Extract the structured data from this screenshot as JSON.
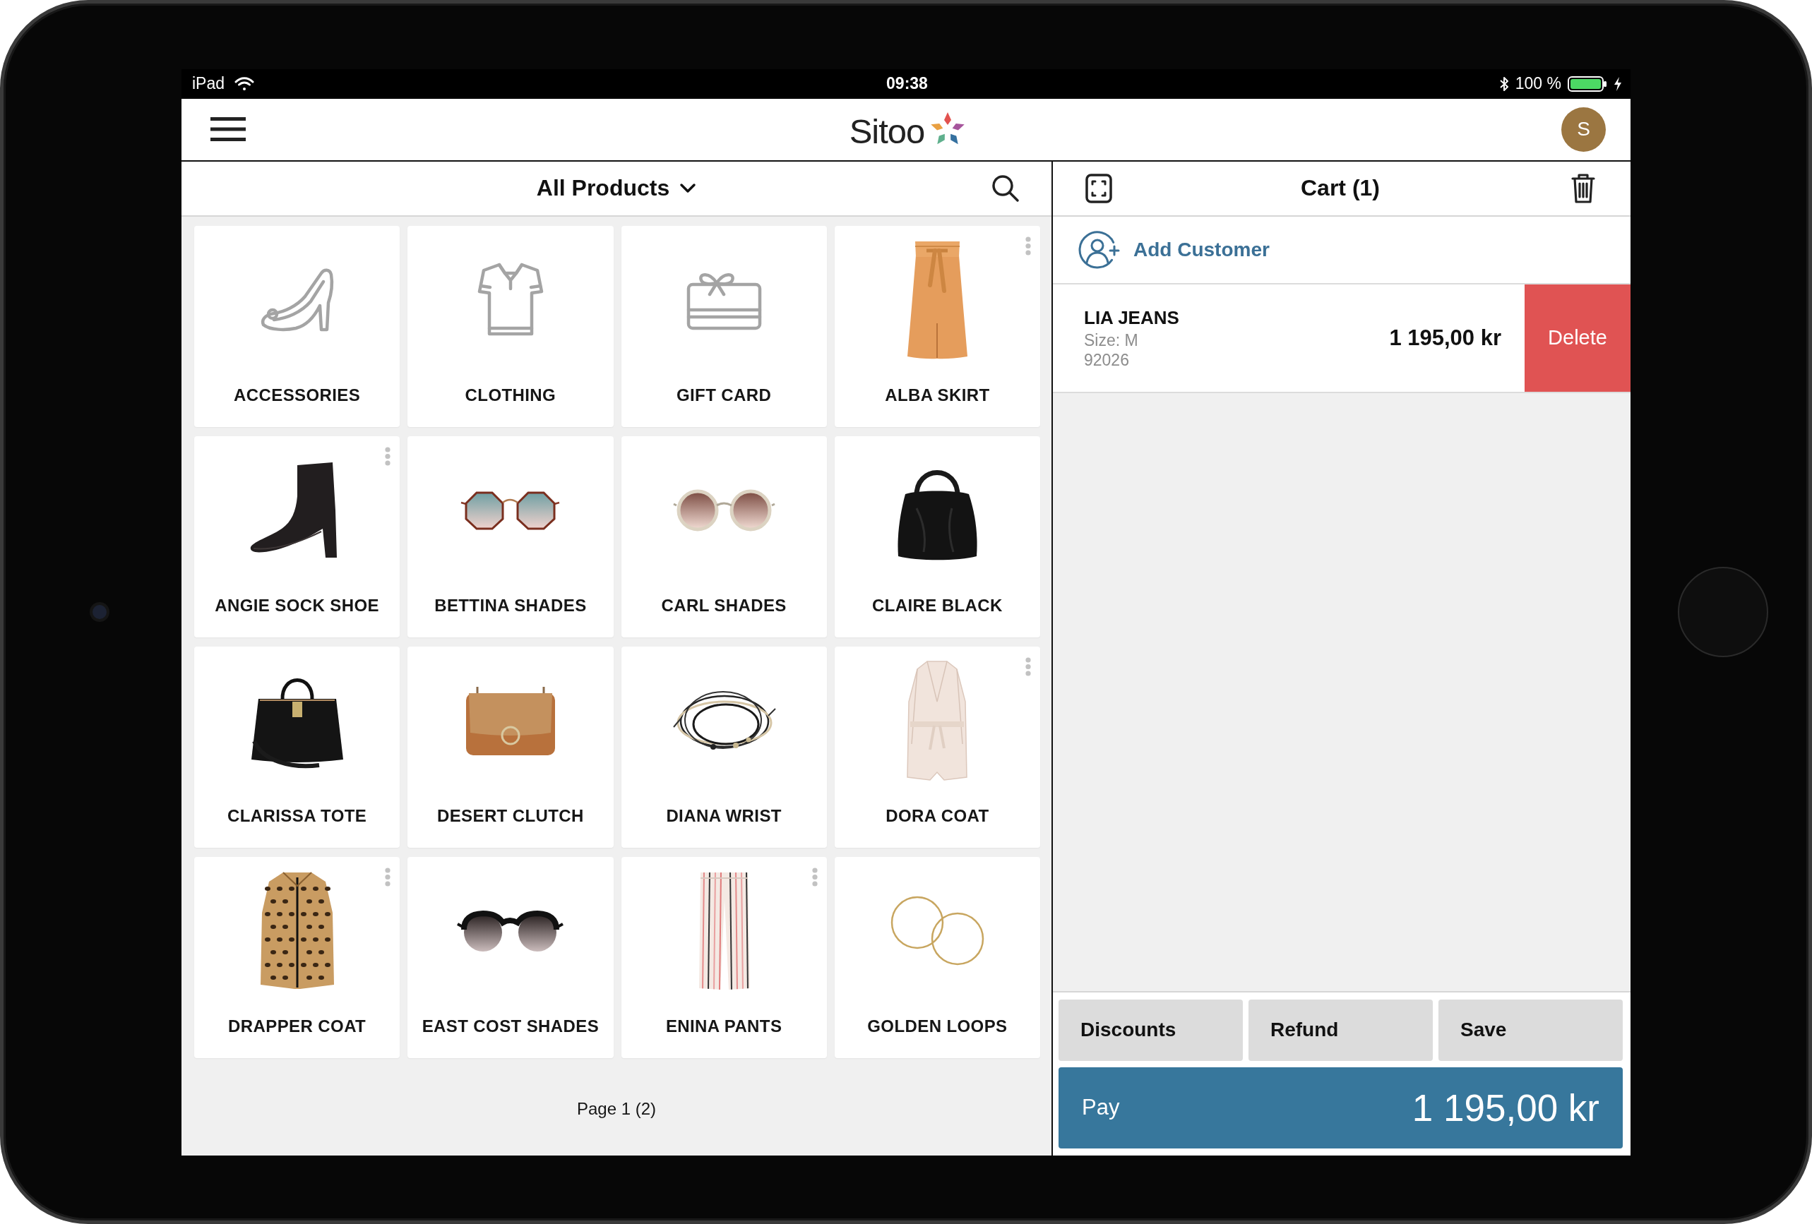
{
  "status_bar": {
    "device": "iPad",
    "time": "09:38",
    "battery": "100 %"
  },
  "header": {
    "logo": "Sitoo",
    "avatar": "S"
  },
  "products": {
    "title": "All Products",
    "tiles": [
      {
        "label": "ACCESSORIES",
        "options_menu": false
      },
      {
        "label": "CLOTHING",
        "options_menu": false
      },
      {
        "label": "GIFT CARD",
        "options_menu": false
      },
      {
        "label": "ALBA SKIRT",
        "options_menu": true
      },
      {
        "label": "ANGIE SOCK SHOE",
        "options_menu": true
      },
      {
        "label": "BETTINA SHADES",
        "options_menu": false
      },
      {
        "label": "CARL SHADES",
        "options_menu": false
      },
      {
        "label": "CLAIRE BLACK",
        "options_menu": false
      },
      {
        "label": "CLARISSA TOTE",
        "options_menu": false
      },
      {
        "label": "DESERT CLUTCH",
        "options_menu": false
      },
      {
        "label": "DIANA WRIST",
        "options_menu": false
      },
      {
        "label": "DORA COAT",
        "options_menu": true
      },
      {
        "label": "DRAPPER COAT",
        "options_menu": true
      },
      {
        "label": "EAST COST SHADES",
        "options_menu": false
      },
      {
        "label": "ENINA PANTS",
        "options_menu": true
      },
      {
        "label": "GOLDEN LOOPS",
        "options_menu": false
      }
    ],
    "pagination": "Page 1 (2)"
  },
  "cart": {
    "title": "Cart (1)",
    "add_customer": "Add Customer",
    "items": [
      {
        "name": "LIA JEANS",
        "details": [
          "Size: M",
          "92026"
        ],
        "price": "1 195,00 kr",
        "delete": "Delete"
      }
    ],
    "actions": [
      "Discounts",
      "Refund",
      "Save"
    ],
    "pay": {
      "label": "Pay",
      "amount": "1 195,00 kr"
    }
  }
}
